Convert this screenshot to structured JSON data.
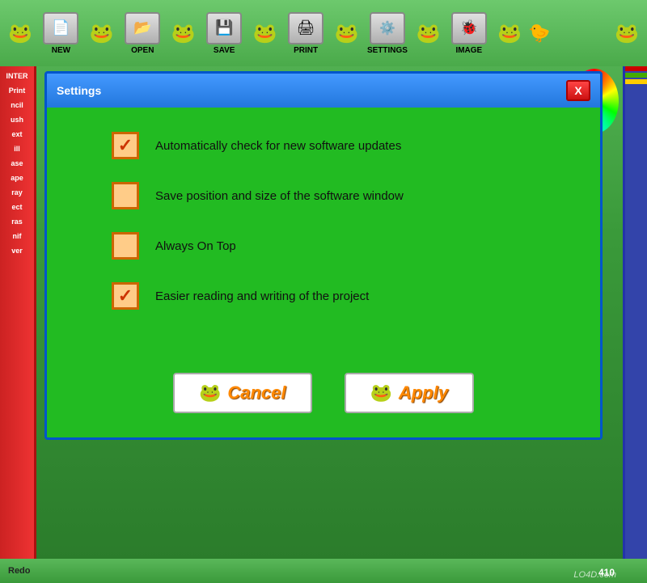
{
  "toolbar": {
    "buttons": [
      {
        "label": "NEW",
        "icon": "🐸",
        "name": "new-button"
      },
      {
        "label": "OPEN",
        "icon": "📂",
        "name": "open-button"
      },
      {
        "label": "SAVE",
        "icon": "💾",
        "name": "save-button"
      },
      {
        "label": "PRINT",
        "icon": "🖨",
        "name": "print-button"
      },
      {
        "label": "SETTINGS",
        "icon": "⚙",
        "name": "settings-button"
      },
      {
        "label": "IMAGE",
        "icon": "🖼",
        "name": "image-button"
      }
    ]
  },
  "sidebar": {
    "items": [
      {
        "label": "INTER"
      },
      {
        "label": "Print"
      },
      {
        "label": "ncil"
      },
      {
        "label": "ush"
      },
      {
        "label": "ext"
      },
      {
        "label": "ill"
      },
      {
        "label": "ase"
      },
      {
        "label": "ape"
      },
      {
        "label": "ray"
      },
      {
        "label": "ect"
      },
      {
        "label": "ras"
      },
      {
        "label": "nif"
      },
      {
        "label": "ver"
      }
    ]
  },
  "dialog": {
    "title": "Settings",
    "close_label": "X",
    "checkboxes": [
      {
        "label": "Automatically check for new software updates",
        "checked": true,
        "name": "auto-update-checkbox"
      },
      {
        "label": "Save position and size of the software window",
        "checked": false,
        "name": "save-position-checkbox"
      },
      {
        "label": "Always On Top",
        "checked": false,
        "name": "always-on-top-checkbox"
      },
      {
        "label": "Easier reading and writing of the project",
        "checked": true,
        "name": "easier-reading-checkbox"
      }
    ],
    "cancel_button": "Cancel",
    "apply_button": "Apply"
  },
  "bottom": {
    "redo_label": "Redo",
    "counter": "410",
    "watermark": "LO4D.com"
  }
}
